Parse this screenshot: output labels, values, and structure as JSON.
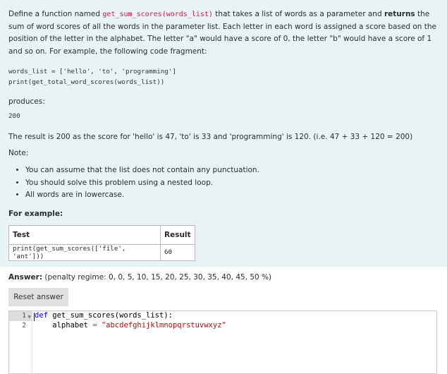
{
  "question": {
    "intro_1": "Define a function named ",
    "intro_func": "get_sum_scores(words_list)",
    "intro_2": " that takes a list of words as a parameter and ",
    "intro_returns": "returns",
    "intro_3": " the sum of word scores of all the words in the parameter list. Each letter in each word is assigned a score based on the position of the letter in the alphabet. The letter \"a\" would have a score of 0, the letter \"b\" would have a score of 1 and so on. For example, the following code fragment:",
    "example_code_line1": "words_list = ['hello', 'to', 'programming']",
    "example_code_line2": "print(get_total_word_scores(words_list))",
    "produces_label": "produces:",
    "produces_output": "200",
    "result_text": "The result is 200 as the score for 'hello' is 47, 'to' is 33 and 'programming' is 120. (i.e. 47 + 33 + 120 = 200)",
    "note_label": "Note:",
    "notes": [
      "You can assume that the list does not contain any punctuation.",
      "You should solve this problem using a nested loop.",
      "All words are in lowercase."
    ],
    "for_example_label": "For example:",
    "table": {
      "headers": [
        "Test",
        "Result"
      ],
      "rows": [
        [
          "print(get_sum_scores(['file', 'ant']))",
          "60"
        ]
      ]
    }
  },
  "answer": {
    "label": "Answer:",
    "penalty": "(penalty regime: 0, 0, 5, 10, 15, 20, 25, 30, 35, 40, 45, 50 %)",
    "reset_button": "Reset answer"
  },
  "editor": {
    "line_numbers": [
      "1",
      "2"
    ],
    "line1_kw": "def",
    "line1_rest": " get_sum_scores(words_list):",
    "line2_indent": "    alphabet ",
    "line2_op": "=",
    "line2_sp": " ",
    "line2_str": "\"abcdefghijklmnopqrstuvwxyz\""
  }
}
